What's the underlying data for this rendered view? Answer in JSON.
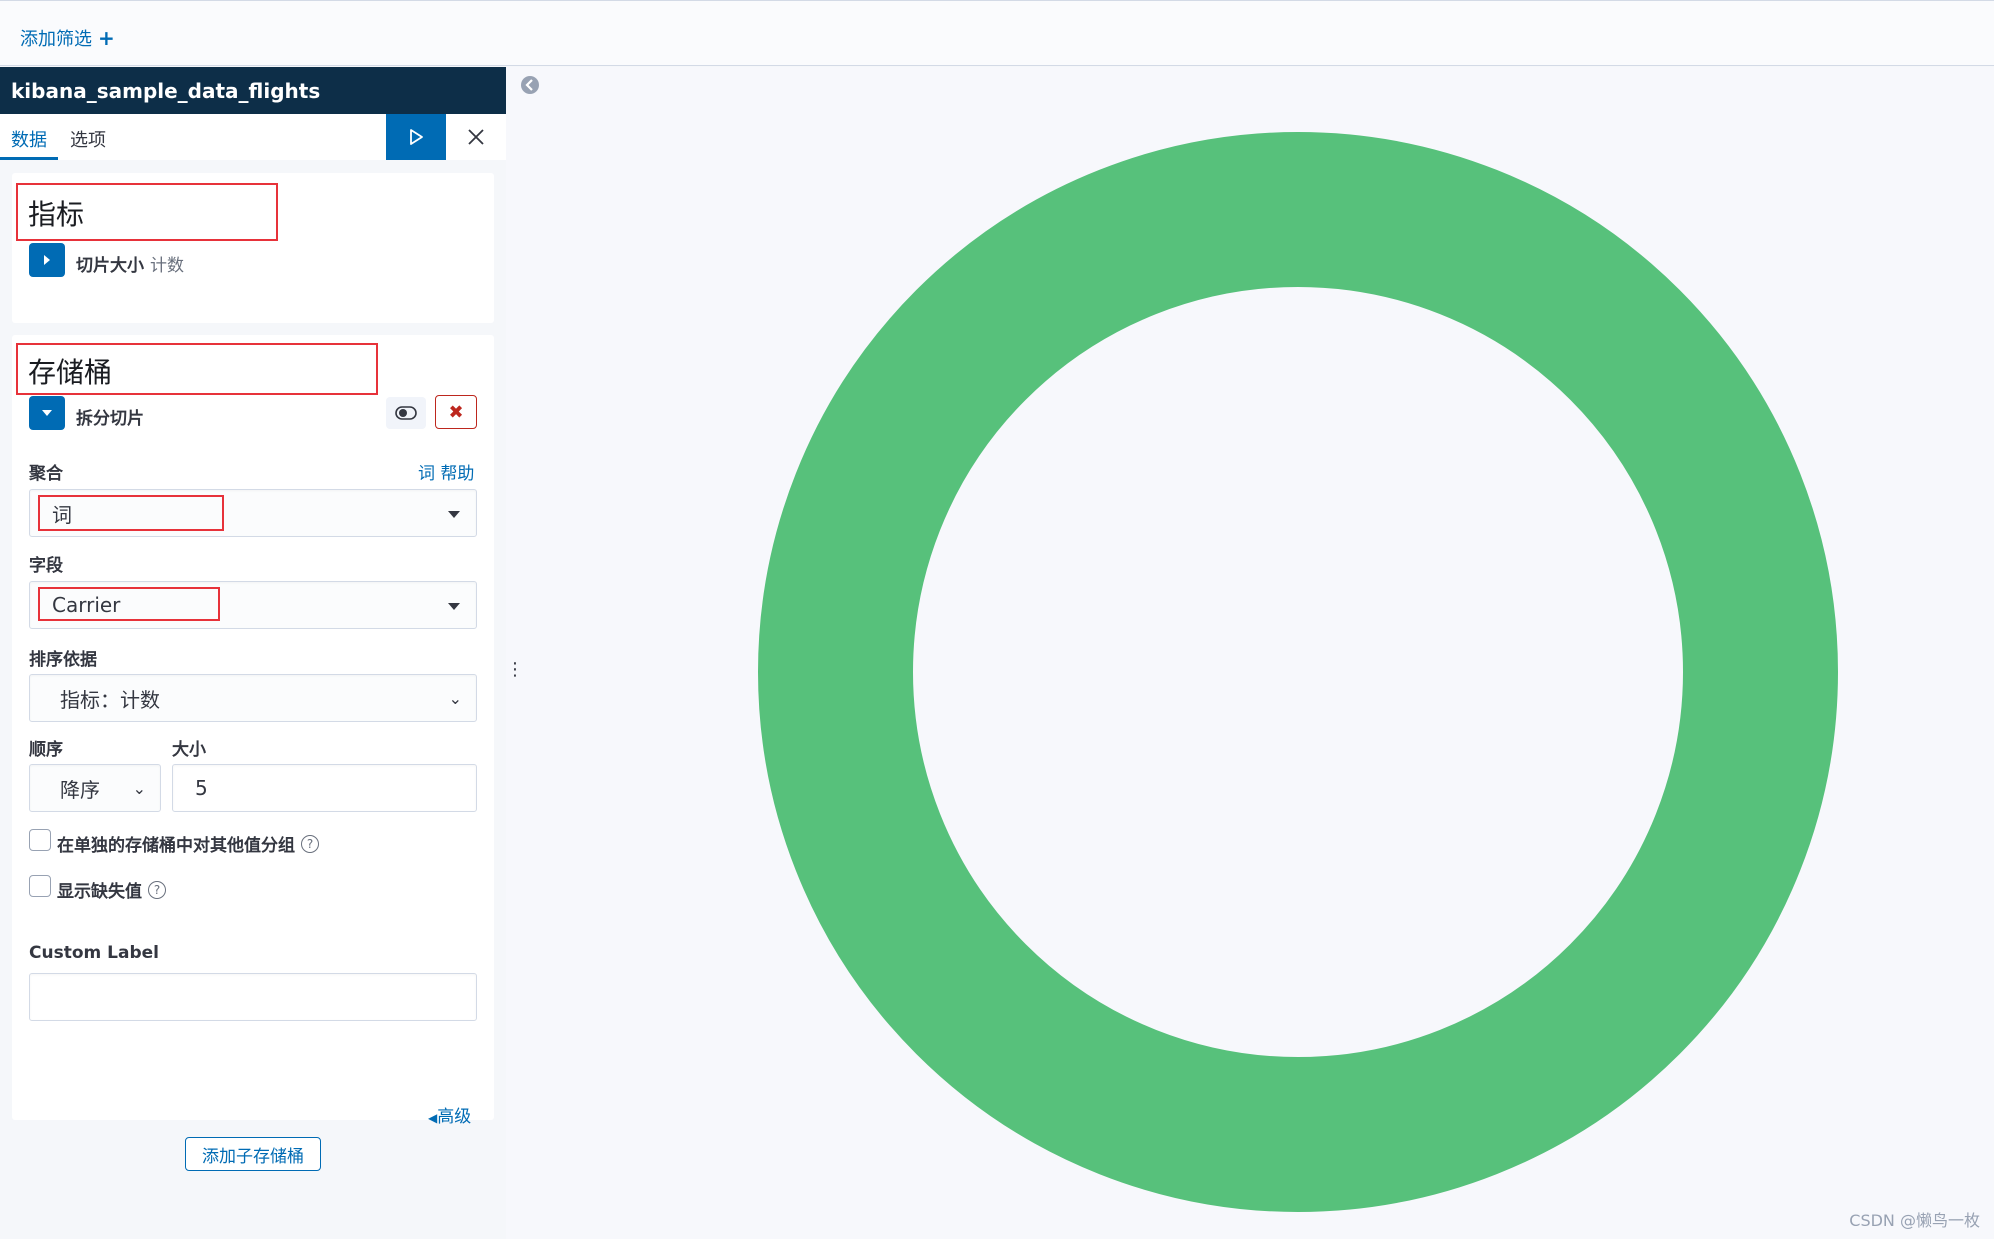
{
  "topbar": {
    "add_filter_label": "添加筛选",
    "add_filter_icon": "plus-icon"
  },
  "sidebar": {
    "index_name": "kibana_sample_data_flights",
    "tabs": [
      {
        "label": "数据",
        "active": true
      },
      {
        "label": "选项",
        "active": false
      }
    ],
    "apply_icon": "play-icon",
    "close_icon": "close-icon"
  },
  "metrics": {
    "title": "指标",
    "agg_title": "切片大小",
    "agg_sub": "计数"
  },
  "buckets": {
    "title": "存储桶",
    "agg_title": "拆分切片",
    "aggregation_label": "聚合",
    "help_link": "词 帮助",
    "aggregation_value": "词",
    "field_label": "字段",
    "field_value": "Carrier",
    "order_by_label": "排序依据",
    "order_by_value": "指标：计数",
    "order_label": "顺序",
    "order_value": "降序",
    "size_label": "大小",
    "size_value": "5",
    "group_other_label": "在单独的存储桶中对其他值分组",
    "show_missing_label": "显示缺失值",
    "custom_label_label": "Custom Label",
    "custom_label_value": "",
    "advanced_label": "高级",
    "add_sub_bucket_label": "添加子存储桶"
  },
  "chart_data": {
    "type": "pie",
    "donut": true,
    "categories": [
      ""
    ],
    "values": [
      100
    ],
    "colors": [
      "#57c17b"
    ]
  },
  "watermark": "CSDN @懒鸟一枚",
  "colors": {
    "accent": "#006bb4",
    "header_bg": "#0d2e48",
    "donut": "#57c17b",
    "highlight": "#e7323a"
  }
}
